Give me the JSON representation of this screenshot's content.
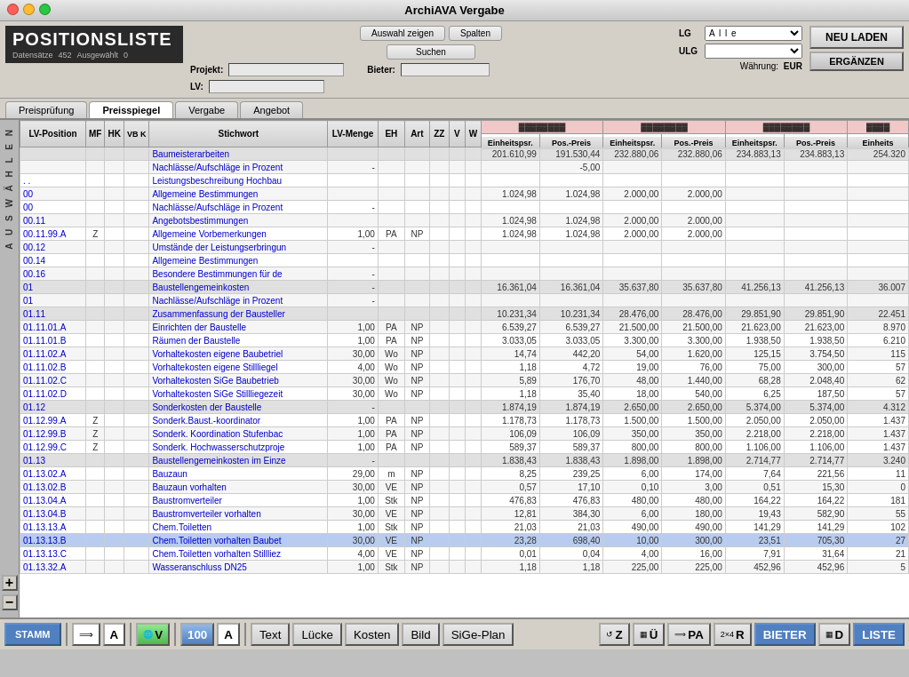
{
  "window": {
    "title": "ArchiAVA Vergabe"
  },
  "header": {
    "pos_title": "POSITIONSLISTE",
    "datensaetze_label": "Datensätze",
    "datensaetze_value": "452",
    "ausgewaehlt_label": "Ausgewählt",
    "ausgewaehlt_value": "0",
    "auswahl_zeigen": "Auswahl zeigen",
    "spalten": "Spalten",
    "suchen": "Suchen",
    "projekt_label": "Projekt:",
    "projekt_value": "",
    "lv_label": "LV:",
    "lv_value": "",
    "bieter_label": "Bieter:",
    "bieter_value": "",
    "lg_label": "LG",
    "lg_value": "A l l e",
    "ulg_label": "ULG",
    "ulg_value": "",
    "waehrung_label": "Währung:",
    "waehrung_value": "EUR",
    "neu_laden": "NEU LADEN",
    "ergaenzen": "ERGÄNZEN"
  },
  "tabs": [
    {
      "label": "Preisprüfung",
      "active": false
    },
    {
      "label": "Preisspiegel",
      "active": true
    },
    {
      "label": "Vergabe",
      "active": false
    },
    {
      "label": "Angebot",
      "active": false
    }
  ],
  "side_panel": {
    "text": "A U S W Ä H L E N",
    "plus": "+",
    "minus": "−"
  },
  "table": {
    "headers": [
      "LV-Position",
      "MF",
      "HK",
      "VB K",
      "Stichwort",
      "LV-Menge",
      "EH",
      "Art",
      "ZZ",
      "V",
      "W",
      "Einheitspsr.",
      "Pos.-Preis",
      "Einheitspsr.",
      "Pos.-Preis",
      "Einheitspsr.",
      "Pos.-Preis",
      "Einheits"
    ],
    "rows": [
      {
        "pos": "",
        "mf": "",
        "hk": "",
        "vbk": "",
        "stichwort": "Baumeisterarbeiten",
        "menge": "",
        "eh": "",
        "art": "",
        "zz": "",
        "v": "",
        "w": "",
        "ep1": "201.610,99",
        "pp1": "191.530,44",
        "ep2": "232.880,06",
        "pp2": "232.880,06",
        "ep3": "234.883,13",
        "pp3": "234.883,13",
        "ep4": "254.320",
        "type": "section"
      },
      {
        "pos": "",
        "mf": "",
        "hk": "",
        "vbk": "",
        "stichwort": "Nachlässe/Aufschläge in Prozent",
        "menge": "-",
        "eh": "",
        "art": "",
        "zz": "",
        "v": "",
        "w": "",
        "ep1": "",
        "pp1": "-5,00",
        "ep2": "",
        "pp2": "",
        "ep3": "",
        "pp3": "",
        "ep4": "",
        "type": "normal"
      },
      {
        "pos": ". .",
        "mf": "",
        "hk": "",
        "vbk": "",
        "stichwort": "Leistungsbeschreibung Hochbau",
        "menge": "",
        "eh": "",
        "art": "",
        "zz": "",
        "v": "",
        "w": "",
        "ep1": "",
        "pp1": "",
        "ep2": "",
        "pp2": "",
        "ep3": "",
        "pp3": "",
        "ep4": "",
        "type": "normal"
      },
      {
        "pos": "00",
        "mf": "",
        "hk": "",
        "vbk": "",
        "stichwort": "Allgemeine Bestimmungen",
        "menge": "",
        "eh": "",
        "art": "",
        "zz": "",
        "v": "",
        "w": "",
        "ep1": "1.024,98",
        "pp1": "1.024,98",
        "ep2": "2.000,00",
        "pp2": "2.000,00",
        "ep3": "",
        "pp3": "",
        "ep4": "",
        "type": "normal"
      },
      {
        "pos": "00",
        "mf": "",
        "hk": "",
        "vbk": "",
        "stichwort": "Nachlässe/Aufschläge in Prozent",
        "menge": "-",
        "eh": "",
        "art": "",
        "zz": "",
        "v": "",
        "w": "",
        "ep1": "",
        "pp1": "",
        "ep2": "",
        "pp2": "",
        "ep3": "",
        "pp3": "",
        "ep4": "",
        "type": "normal"
      },
      {
        "pos": "00.11",
        "mf": "",
        "hk": "",
        "vbk": "",
        "stichwort": "Angebotsbestimmungen",
        "menge": "",
        "eh": "",
        "art": "",
        "zz": "",
        "v": "",
        "w": "",
        "ep1": "1.024,98",
        "pp1": "1.024,98",
        "ep2": "2.000,00",
        "pp2": "2.000,00",
        "ep3": "",
        "pp3": "",
        "ep4": "",
        "type": "normal"
      },
      {
        "pos": "00.11.99.A",
        "mf": "Z",
        "hk": "",
        "vbk": "",
        "stichwort": "Allgemeine Vorbemerkungen",
        "menge": "1,00",
        "eh": "PA",
        "art": "NP",
        "zz": "",
        "v": "",
        "w": "",
        "ep1": "1.024,98",
        "pp1": "1.024,98",
        "ep2": "2.000,00",
        "pp2": "2.000,00",
        "ep3": "",
        "pp3": "",
        "ep4": "",
        "type": "normal"
      },
      {
        "pos": "00.12",
        "mf": "",
        "hk": "",
        "vbk": "",
        "stichwort": "Umstände der Leistungserbringun",
        "menge": "-",
        "eh": "",
        "art": "",
        "zz": "",
        "v": "",
        "w": "",
        "ep1": "",
        "pp1": "",
        "ep2": "",
        "pp2": "",
        "ep3": "",
        "pp3": "",
        "ep4": "",
        "type": "normal"
      },
      {
        "pos": "00.14",
        "mf": "",
        "hk": "",
        "vbk": "",
        "stichwort": "Allgemeine Bestimmungen",
        "menge": "",
        "eh": "",
        "art": "",
        "zz": "",
        "v": "",
        "w": "",
        "ep1": "",
        "pp1": "",
        "ep2": "",
        "pp2": "",
        "ep3": "",
        "pp3": "",
        "ep4": "",
        "type": "normal"
      },
      {
        "pos": "00.16",
        "mf": "",
        "hk": "",
        "vbk": "",
        "stichwort": "Besondere Bestimmungen für de",
        "menge": "-",
        "eh": "",
        "art": "",
        "zz": "",
        "v": "",
        "w": "",
        "ep1": "",
        "pp1": "",
        "ep2": "",
        "pp2": "",
        "ep3": "",
        "pp3": "",
        "ep4": "",
        "type": "normal"
      },
      {
        "pos": "01",
        "mf": "",
        "hk": "",
        "vbk": "",
        "stichwort": "Baustellengemeinkosten",
        "menge": "-",
        "eh": "",
        "art": "",
        "zz": "",
        "v": "",
        "w": "",
        "ep1": "16.361,04",
        "pp1": "16.361,04",
        "ep2": "35.637,80",
        "pp2": "35.637,80",
        "ep3": "41.256,13",
        "pp3": "41.256,13",
        "ep4": "36.007",
        "type": "section"
      },
      {
        "pos": "01",
        "mf": "",
        "hk": "",
        "vbk": "",
        "stichwort": "Nachlässe/Aufschläge in Prozent",
        "menge": "-",
        "eh": "",
        "art": "",
        "zz": "",
        "v": "",
        "w": "",
        "ep1": "",
        "pp1": "",
        "ep2": "",
        "pp2": "",
        "ep3": "",
        "pp3": "",
        "ep4": "",
        "type": "normal"
      },
      {
        "pos": "01.11",
        "mf": "",
        "hk": "",
        "vbk": "",
        "stichwort": "Zusammenfassung der Bausteller",
        "menge": "",
        "eh": "",
        "art": "",
        "zz": "",
        "v": "",
        "w": "",
        "ep1": "10.231,34",
        "pp1": "10.231,34",
        "ep2": "28.476,00",
        "pp2": "28.476,00",
        "ep3": "29.851,90",
        "pp3": "29.851,90",
        "ep4": "22.451",
        "type": "section"
      },
      {
        "pos": "01.11.01.A",
        "mf": "",
        "hk": "",
        "vbk": "",
        "stichwort": "Einrichten der Baustelle",
        "menge": "1,00",
        "eh": "PA",
        "art": "NP",
        "zz": "",
        "v": "",
        "w": "",
        "ep1": "6.539,27",
        "pp1": "6.539,27",
        "ep2": "21.500,00",
        "pp2": "21.500,00",
        "ep3": "21.623,00",
        "pp3": "21.623,00",
        "ep4": "8.970",
        "type": "normal"
      },
      {
        "pos": "01.11.01.B",
        "mf": "",
        "hk": "",
        "vbk": "",
        "stichwort": "Räumen der Baustelle",
        "menge": "1,00",
        "eh": "PA",
        "art": "NP",
        "zz": "",
        "v": "",
        "w": "",
        "ep1": "3.033,05",
        "pp1": "3.033,05",
        "ep2": "3.300,00",
        "pp2": "3.300,00",
        "ep3": "1.938,50",
        "pp3": "1.938,50",
        "ep4": "6.210",
        "type": "normal"
      },
      {
        "pos": "01.11.02.A",
        "mf": "",
        "hk": "",
        "vbk": "",
        "stichwort": "Vorhaltekosten eigene Baubetriel",
        "menge": "30,00",
        "eh": "Wo",
        "art": "NP",
        "zz": "",
        "v": "",
        "w": "",
        "ep1": "14,74",
        "pp1": "442,20",
        "ep2": "54,00",
        "pp2": "1.620,00",
        "ep3": "125,15",
        "pp3": "3.754,50",
        "ep4": "115",
        "type": "normal"
      },
      {
        "pos": "01.11.02.B",
        "mf": "",
        "hk": "",
        "vbk": "",
        "stichwort": "Vorhaltekosten eigene Stillliegel",
        "menge": "4,00",
        "eh": "Wo",
        "art": "NP",
        "zz": "",
        "v": "",
        "w": "",
        "ep1": "1,18",
        "pp1": "4,72",
        "ep2": "19,00",
        "pp2": "76,00",
        "ep3": "75,00",
        "pp3": "300,00",
        "ep4": "57",
        "type": "normal"
      },
      {
        "pos": "01.11.02.C",
        "mf": "",
        "hk": "",
        "vbk": "",
        "stichwort": "Vorhaltekosten SiGe Baubetrieb",
        "menge": "30,00",
        "eh": "Wo",
        "art": "NP",
        "zz": "",
        "v": "",
        "w": "",
        "ep1": "5,89",
        "pp1": "176,70",
        "ep2": "48,00",
        "pp2": "1.440,00",
        "ep3": "68,28",
        "pp3": "2.048,40",
        "ep4": "62",
        "type": "normal"
      },
      {
        "pos": "01.11.02.D",
        "mf": "",
        "hk": "",
        "vbk": "",
        "stichwort": "Vorhaltekosten SiGe Stillliegezeit",
        "menge": "30,00",
        "eh": "Wo",
        "art": "NP",
        "zz": "",
        "v": "",
        "w": "",
        "ep1": "1,18",
        "pp1": "35,40",
        "ep2": "18,00",
        "pp2": "540,00",
        "ep3": "6,25",
        "pp3": "187,50",
        "ep4": "57",
        "type": "normal"
      },
      {
        "pos": "01.12",
        "mf": "",
        "hk": "",
        "vbk": "",
        "stichwort": "Sonderkosten der Baustelle",
        "menge": "-",
        "eh": "",
        "art": "",
        "zz": "",
        "v": "",
        "w": "",
        "ep1": "1.874,19",
        "pp1": "1.874,19",
        "ep2": "2.650,00",
        "pp2": "2.650,00",
        "ep3": "5.374,00",
        "pp3": "5.374,00",
        "ep4": "4.312",
        "type": "section"
      },
      {
        "pos": "01.12.99.A",
        "mf": "Z",
        "hk": "",
        "vbk": "",
        "stichwort": "Sonderk.Baust.-koordinator",
        "menge": "1,00",
        "eh": "PA",
        "art": "NP",
        "zz": "",
        "v": "",
        "w": "",
        "ep1": "1.178,73",
        "pp1": "1.178,73",
        "ep2": "1.500,00",
        "pp2": "1.500,00",
        "ep3": "2.050,00",
        "pp3": "2.050,00",
        "ep4": "1.437",
        "type": "normal"
      },
      {
        "pos": "01.12.99.B",
        "mf": "Z",
        "hk": "",
        "vbk": "",
        "stichwort": "Sonderk. Koordination Stufenbac",
        "menge": "1,00",
        "eh": "PA",
        "art": "NP",
        "zz": "",
        "v": "",
        "w": "",
        "ep1": "106,09",
        "pp1": "106,09",
        "ep2": "350,00",
        "pp2": "350,00",
        "ep3": "2.218,00",
        "pp3": "2.218,00",
        "ep4": "1.437",
        "type": "normal"
      },
      {
        "pos": "01.12.99.C",
        "mf": "Z",
        "hk": "",
        "vbk": "",
        "stichwort": "Sonderk. Hochwasserschutzproje",
        "menge": "1,00",
        "eh": "PA",
        "art": "NP",
        "zz": "",
        "v": "",
        "w": "",
        "ep1": "589,37",
        "pp1": "589,37",
        "ep2": "800,00",
        "pp2": "800,00",
        "ep3": "1.106,00",
        "pp3": "1.106,00",
        "ep4": "1.437",
        "type": "normal"
      },
      {
        "pos": "01.13",
        "mf": "",
        "hk": "",
        "vbk": "",
        "stichwort": "Baustellengemeinkosten im Einze",
        "menge": "-",
        "eh": "",
        "art": "",
        "zz": "",
        "v": "",
        "w": "",
        "ep1": "1.838,43",
        "pp1": "1.838,43",
        "ep2": "1.898,00",
        "pp2": "1.898,00",
        "ep3": "2.714,77",
        "pp3": "2.714,77",
        "ep4": "3.240",
        "type": "section"
      },
      {
        "pos": "01.13.02.A",
        "mf": "",
        "hk": "",
        "vbk": "",
        "stichwort": "Bauzaun",
        "menge": "29,00",
        "eh": "m",
        "art": "NP",
        "zz": "",
        "v": "",
        "w": "",
        "ep1": "8,25",
        "pp1": "239,25",
        "ep2": "6,00",
        "pp2": "174,00",
        "ep3": "7,64",
        "pp3": "221,56",
        "ep4": "11",
        "type": "normal"
      },
      {
        "pos": "01.13.02.B",
        "mf": "",
        "hk": "",
        "vbk": "",
        "stichwort": "Bauzaun vorhalten",
        "menge": "30,00",
        "eh": "VE",
        "art": "NP",
        "zz": "",
        "v": "",
        "w": "",
        "ep1": "0,57",
        "pp1": "17,10",
        "ep2": "0,10",
        "pp2": "3,00",
        "ep3": "0,51",
        "pp3": "15,30",
        "ep4": "0",
        "type": "normal"
      },
      {
        "pos": "01.13.04.A",
        "mf": "",
        "hk": "",
        "vbk": "",
        "stichwort": "Baustromverteiler",
        "menge": "1,00",
        "eh": "Stk",
        "art": "NP",
        "zz": "",
        "v": "",
        "w": "",
        "ep1": "476,83",
        "pp1": "476,83",
        "ep2": "480,00",
        "pp2": "480,00",
        "ep3": "164,22",
        "pp3": "164,22",
        "ep4": "181",
        "type": "normal"
      },
      {
        "pos": "01.13.04.B",
        "mf": "",
        "hk": "",
        "vbk": "",
        "stichwort": "Baustromverteiler vorhalten",
        "menge": "30,00",
        "eh": "VE",
        "art": "NP",
        "zz": "",
        "v": "",
        "w": "",
        "ep1": "12,81",
        "pp1": "384,30",
        "ep2": "6,00",
        "pp2": "180,00",
        "ep3": "19,43",
        "pp3": "582,90",
        "ep4": "55",
        "type": "normal"
      },
      {
        "pos": "01.13.13.A",
        "mf": "",
        "hk": "",
        "vbk": "",
        "stichwort": "Chem.Toiletten",
        "menge": "1,00",
        "eh": "Stk",
        "art": "NP",
        "zz": "",
        "v": "",
        "w": "",
        "ep1": "21,03",
        "pp1": "21,03",
        "ep2": "490,00",
        "pp2": "490,00",
        "ep3": "141,29",
        "pp3": "141,29",
        "ep4": "102",
        "type": "normal"
      },
      {
        "pos": "01.13.13.B",
        "mf": "",
        "hk": "",
        "vbk": "",
        "stichwort": "Chem.Toiletten vorhalten Baubet",
        "menge": "30,00",
        "eh": "VE",
        "art": "NP",
        "zz": "",
        "v": "",
        "w": "",
        "ep1": "23,28",
        "pp1": "698,40",
        "ep2": "10,00",
        "pp2": "300,00",
        "ep3": "23,51",
        "pp3": "705,30",
        "ep4": "27",
        "type": "highlighted"
      },
      {
        "pos": "01.13.13.C",
        "mf": "",
        "hk": "",
        "vbk": "",
        "stichwort": "Chem.Toiletten vorhalten Stillliez",
        "menge": "4,00",
        "eh": "VE",
        "art": "NP",
        "zz": "",
        "v": "",
        "w": "",
        "ep1": "0,01",
        "pp1": "0,04",
        "ep2": "4,00",
        "pp2": "16,00",
        "ep3": "7,91",
        "pp3": "31,64",
        "ep4": "21",
        "type": "normal"
      },
      {
        "pos": "01.13.32.A",
        "mf": "",
        "hk": "",
        "vbk": "",
        "stichwort": "Wasseranschluss DN25",
        "menge": "1,00",
        "eh": "Stk",
        "art": "NP",
        "zz": "",
        "v": "",
        "w": "",
        "ep1": "1,18",
        "pp1": "1,18",
        "ep2": "225,00",
        "pp2": "225,00",
        "ep3": "452,96",
        "pp3": "452,96",
        "ep4": "5",
        "type": "normal"
      }
    ]
  },
  "bottom_toolbar": {
    "stamm": "STAMM",
    "arrow_a": "A",
    "v_btn": "V",
    "a_btn2": "A",
    "text": "Text",
    "luecke": "Lücke",
    "kosten": "Kosten",
    "bild": "Bild",
    "sige_plan": "SiGe-Plan",
    "z_btn": "Z",
    "u_btn": "Ü",
    "pa_btn": "PA",
    "r_btn": "R",
    "bieter": "BIETER",
    "d_btn": "D",
    "liste": "LISTE"
  }
}
